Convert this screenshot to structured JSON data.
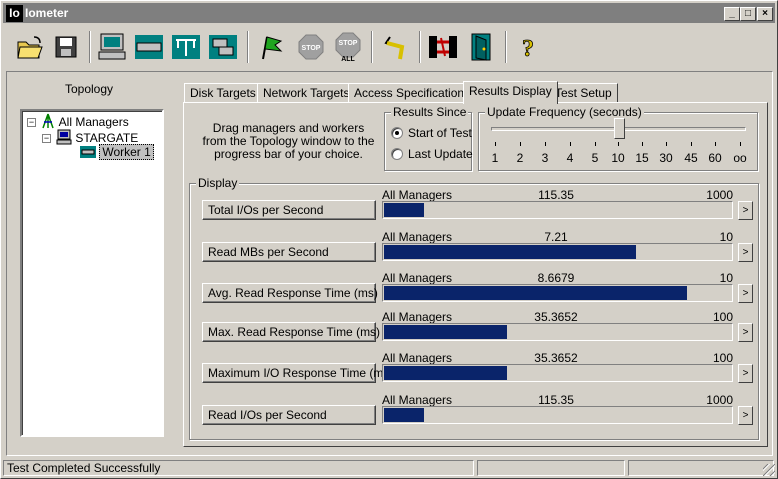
{
  "window": {
    "app_icon_text": "Io",
    "title": "Iometer",
    "caption_buttons": [
      "_",
      "□",
      "×"
    ]
  },
  "toolbar": {
    "buttons": [
      {
        "icon": "open-folder-icon"
      },
      {
        "icon": "save-disk-icon"
      },
      {
        "icon": "start-manager-icon"
      },
      {
        "icon": "new-disk-worker-icon"
      },
      {
        "icon": "new-network-worker-icon"
      },
      {
        "icon": "copy-worker-icon"
      },
      {
        "icon": "start-green-flag-icon"
      },
      {
        "icon": "stop-icon",
        "label": "STOP"
      },
      {
        "icon": "stop-all-icon",
        "label": "STOP",
        "sublabel": "ALL"
      },
      {
        "icon": "reset-workers-icon"
      },
      {
        "icon": "disconnect-icon"
      },
      {
        "icon": "exit-door-icon"
      },
      {
        "icon": "help-icon",
        "label": "?"
      }
    ]
  },
  "topology": {
    "header": "Topology",
    "tree": [
      {
        "label": "All Managers",
        "expander": "−"
      },
      {
        "label": "STARGATE",
        "expander": "−"
      },
      {
        "label": "Worker 1"
      }
    ]
  },
  "tabs": [
    {
      "label": "Disk Targets"
    },
    {
      "label": "Network Targets"
    },
    {
      "label": "Access Specifications"
    },
    {
      "label": "Results Display",
      "active": true
    },
    {
      "label": "Test Setup"
    }
  ],
  "results": {
    "instructions": "Drag managers and workers from the Topology window to the progress bar of your choice.",
    "results_since": {
      "legend": "Results Since",
      "options": [
        {
          "label": "Start of Test",
          "checked": true
        },
        {
          "label": "Last Update",
          "checked": false
        }
      ]
    },
    "update_frequency": {
      "legend": "Update Frequency (seconds)",
      "ticks": [
        "1",
        "2",
        "3",
        "4",
        "5",
        "10",
        "15",
        "30",
        "45",
        "60",
        "oo"
      ],
      "selected": "10"
    },
    "display": {
      "legend": "Display",
      "rows": [
        {
          "metric": "Total I/Os per Second",
          "target": "All Managers",
          "value": "115.35",
          "max": "1000",
          "fraction": 0.1154
        },
        {
          "metric": "Read MBs per Second",
          "target": "All Managers",
          "value": "7.21",
          "max": "10",
          "fraction": 0.721
        },
        {
          "metric": "Avg. Read Response Time (ms)",
          "target": "All Managers",
          "value": "8.6679",
          "max": "10",
          "fraction": 0.8668
        },
        {
          "metric": "Max. Read Response Time (ms)",
          "target": "All Managers",
          "value": "35.3652",
          "max": "100",
          "fraction": 0.3537
        },
        {
          "metric": "Maximum I/O Response Time (ms)",
          "target": "All Managers",
          "value": "35.3652",
          "max": "100",
          "fraction": 0.3537
        },
        {
          "metric": "Read I/Os per Second",
          "target": "All Managers",
          "value": "115.35",
          "max": "1000",
          "fraction": 0.1154
        }
      ]
    }
  },
  "status": {
    "message": "Test Completed Successfully"
  },
  "colors": {
    "face": "#d4d0c8",
    "bar_fill": "#0a246a"
  }
}
